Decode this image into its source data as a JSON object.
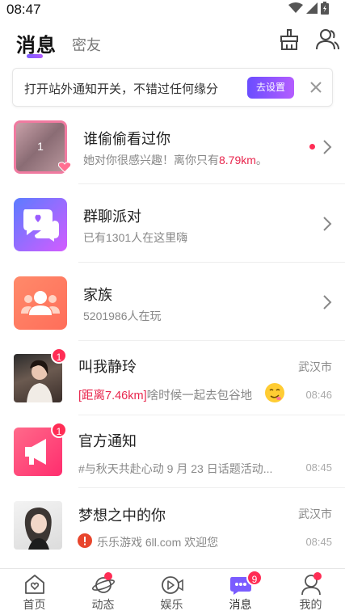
{
  "status_bar": {
    "time": "08:47"
  },
  "header": {
    "active_tab": "消息",
    "inactive_tab": "密友"
  },
  "notice": {
    "text": "打开站外通知开关，不错过任何缘分",
    "button": "去设置"
  },
  "rows": {
    "visitors": {
      "title": "谁偷偷看过你",
      "sub_prefix": "她对你很感兴趣！离你只有",
      "sub_distance": "8.79km",
      "sub_suffix": "。",
      "thumb_count": "1"
    },
    "group": {
      "title": "群聊派对",
      "sub": "已有1301人在这里嗨"
    },
    "family": {
      "title": "家族",
      "sub": "5201986人在玩"
    },
    "chat1": {
      "title": "叫我静玲",
      "city": "武汉市",
      "distance": "[距离7.46km]",
      "message": "啥时候一起去包谷地",
      "time": "08:46",
      "badge": "1"
    },
    "official": {
      "title": "官方通知",
      "message": "#与秋天共赴心动 9 月 23 日话题活动...",
      "time": "08:45",
      "badge": "1"
    },
    "chat2": {
      "title": "梦想之中的你",
      "city": "武汉市",
      "message": "乐乐游戏 6ll.com 欢迎您",
      "time": "08:45"
    }
  },
  "nav": {
    "home": "首页",
    "moments": "动态",
    "entertainment": "娱乐",
    "messages": "消息",
    "messages_badge": "9",
    "me": "我的"
  },
  "colors": {
    "accent": "#7a5cff",
    "badge": "#ff2d55",
    "distance": "#e8264d"
  }
}
